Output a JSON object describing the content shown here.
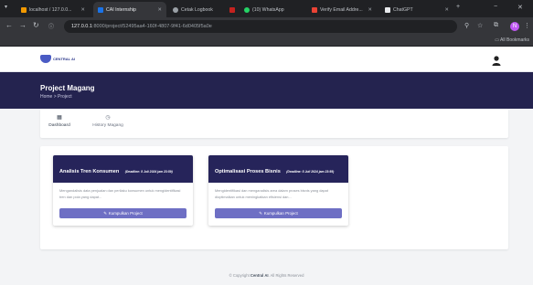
{
  "browser": {
    "tabs": [
      {
        "title": "localhost / 127.0.0...",
        "color": "#f29900"
      },
      {
        "title": "CAI Internship",
        "color": "#1a73e8"
      },
      {
        "title": "Cetak Logbook",
        "color": "#9aa0a6"
      },
      {
        "title": "",
        "color": "#c5221f"
      },
      {
        "title": "(10) WhatsApp",
        "color": "#25d366"
      },
      {
        "title": "Verify Email Addre...",
        "color": "#ea4335"
      },
      {
        "title": "ChatGPT",
        "color": "#e8eaed"
      }
    ],
    "new_tab": "+",
    "minimize": "−",
    "close": "✕",
    "url_host": "127.0.0.1",
    "url_path": ":8000/project/52495aa4-160f-4807-9f41-6d0405f5a0e",
    "all_bookmarks": "All Bookmarks",
    "profile_initial": "N"
  },
  "app": {
    "logo_text": "CENTRAL AI",
    "page_title": "Project Magang",
    "breadcrumb": "Home  >  Project"
  },
  "subnav": {
    "dashboard": "Dashboard",
    "history": "History Magang"
  },
  "projects": [
    {
      "title": "Analisis Tren Konsumen",
      "deadline": "(Deadline: 5 Juli 2024 jam 23:59)",
      "desc": "Mengandalisis data penjualan dan perilaku konsumen untuk mengidentifikasi tren dan pola yang dapat...",
      "button": "Kumpulkan Project"
    },
    {
      "title": "Optimalisasi Proses Bisnis",
      "deadline": "(Deadline: 5 Juli 2024 jam 23:59)",
      "desc": "Mengidentifikasi dan menganalisis area dalam proses bisnis yang dapat dioptimalkan untuk meningkatkan efisiensi dan...",
      "button": "Kumpulkan Project"
    }
  ],
  "footer": {
    "prefix": "© Copyright",
    "brand": "Central AI",
    "suffix": ". All Rights Reserved"
  }
}
